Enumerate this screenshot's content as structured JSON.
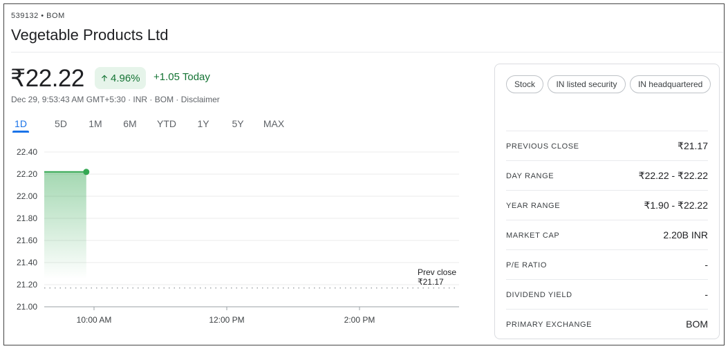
{
  "header": {
    "ticker": "539132 • BOM",
    "company": "Vegetable Products Ltd"
  },
  "quote": {
    "price": "₹22.22",
    "change_pct": "4.96%",
    "change_abs": "+1.05 Today",
    "meta": "Dec 29, 9:53:43 AM GMT+5:30 · INR · BOM · Disclaimer"
  },
  "tabs": [
    {
      "label": "1D",
      "active": true
    },
    {
      "label": "5D"
    },
    {
      "label": "1M"
    },
    {
      "label": "6M"
    },
    {
      "label": "YTD"
    },
    {
      "label": "1Y"
    },
    {
      "label": "5Y"
    },
    {
      "label": "MAX"
    }
  ],
  "colors": {
    "positive": "#137333",
    "line": "#34a853",
    "accent": "#1a73e8"
  },
  "chart_data": {
    "type": "area",
    "ylim": [
      21.0,
      22.4
    ],
    "yticks": [
      "22.40",
      "22.20",
      "22.00",
      "21.80",
      "21.60",
      "21.40",
      "21.20",
      "21.00"
    ],
    "xticks": [
      "10:00 AM",
      "12:00 PM",
      "2:00 PM"
    ],
    "x": [
      "9:15 AM",
      "9:53 AM"
    ],
    "values": [
      22.22,
      22.22
    ],
    "reference": {
      "label": "Prev close",
      "value_label": "₹21.17",
      "value": 21.17
    }
  },
  "chips": [
    "Stock",
    "IN listed security",
    "IN headquartered"
  ],
  "stats": [
    {
      "label": "PREVIOUS CLOSE",
      "value": "₹21.17"
    },
    {
      "label": "DAY RANGE",
      "value": "₹22.22 - ₹22.22"
    },
    {
      "label": "YEAR RANGE",
      "value": "₹1.90 - ₹22.22"
    },
    {
      "label": "MARKET CAP",
      "value": "2.20B INR"
    },
    {
      "label": "P/E RATIO",
      "value": "-"
    },
    {
      "label": "DIVIDEND YIELD",
      "value": "-"
    },
    {
      "label": "PRIMARY EXCHANGE",
      "value": "BOM"
    }
  ]
}
